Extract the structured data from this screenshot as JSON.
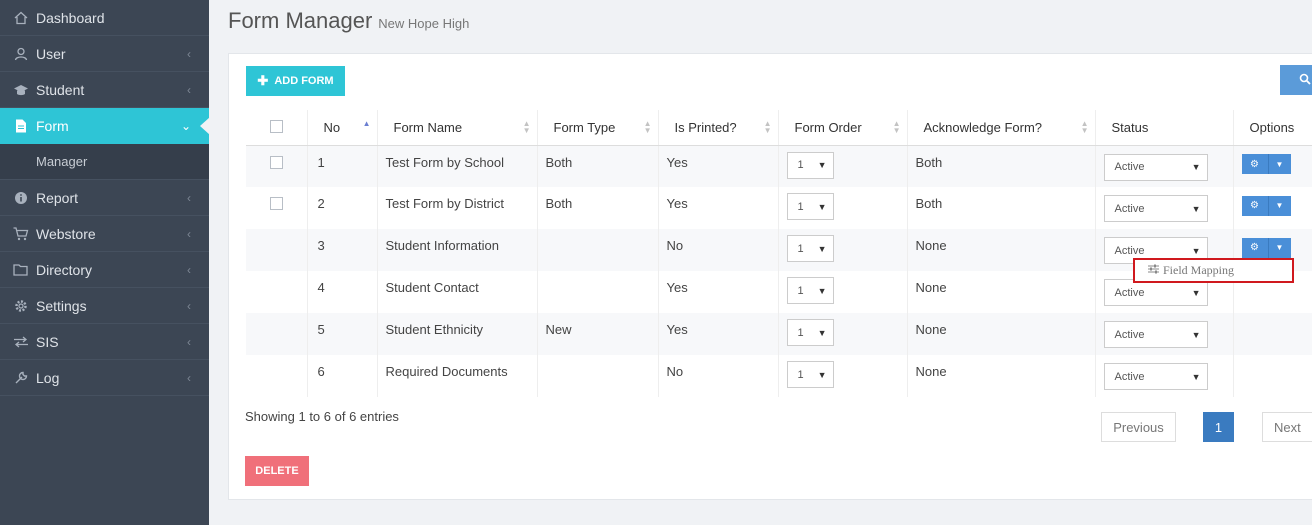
{
  "sidebar": {
    "items": [
      {
        "label": "Dashboard",
        "icon": "home-icon"
      },
      {
        "label": "User",
        "icon": "user-icon"
      },
      {
        "label": "Student",
        "icon": "graduation-cap-icon"
      },
      {
        "label": "Form",
        "icon": "file-icon",
        "active": true
      },
      {
        "label": "Manager",
        "sub": true
      },
      {
        "label": "Report",
        "icon": "info-icon"
      },
      {
        "label": "Webstore",
        "icon": "cart-icon"
      },
      {
        "label": "Directory",
        "icon": "folder-icon"
      },
      {
        "label": "Settings",
        "icon": "gear-icon"
      },
      {
        "label": "SIS",
        "icon": "exchange-icon"
      },
      {
        "label": "Log",
        "icon": "wrench-icon"
      }
    ]
  },
  "header": {
    "title": "Form Manager",
    "subtitle": "New Hope High"
  },
  "toolbar": {
    "add_label": "ADD FORM",
    "delete_label": "DELETE"
  },
  "table": {
    "columns": [
      "No",
      "Form Name",
      "Form Type",
      "Is Printed?",
      "Form Order",
      "Acknowledge Form?",
      "Status",
      "Options"
    ],
    "rows": [
      {
        "no": "1",
        "name": "Test Form by School",
        "type": "Both",
        "printed": "Yes",
        "order": "1",
        "ack": "Both",
        "status": "Active",
        "checkbox": true,
        "options": true
      },
      {
        "no": "2",
        "name": "Test Form by District",
        "type": "Both",
        "printed": "Yes",
        "order": "1",
        "ack": "Both",
        "status": "Active",
        "checkbox": true,
        "options": true
      },
      {
        "no": "3",
        "name": "Student Information",
        "type": "",
        "printed": "No",
        "order": "1",
        "ack": "None",
        "status": "Active",
        "checkbox": false,
        "options": true
      },
      {
        "no": "4",
        "name": "Student Contact",
        "type": "",
        "printed": "Yes",
        "order": "1",
        "ack": "None",
        "status": "Active",
        "checkbox": false,
        "options": false
      },
      {
        "no": "5",
        "name": "Student Ethnicity",
        "type": "New",
        "printed": "Yes",
        "order": "1",
        "ack": "None",
        "status": "Active",
        "checkbox": false,
        "options": false
      },
      {
        "no": "6",
        "name": "Required Documents",
        "type": "",
        "printed": "No",
        "order": "1",
        "ack": "None",
        "status": "Active",
        "checkbox": false,
        "options": false
      }
    ]
  },
  "dropdown": {
    "item": "Field Mapping",
    "icon": "sliders-icon"
  },
  "footer": {
    "info": "Showing 1 to 6 of 6 entries",
    "previous": "Previous",
    "page": "1",
    "next": "Next"
  }
}
